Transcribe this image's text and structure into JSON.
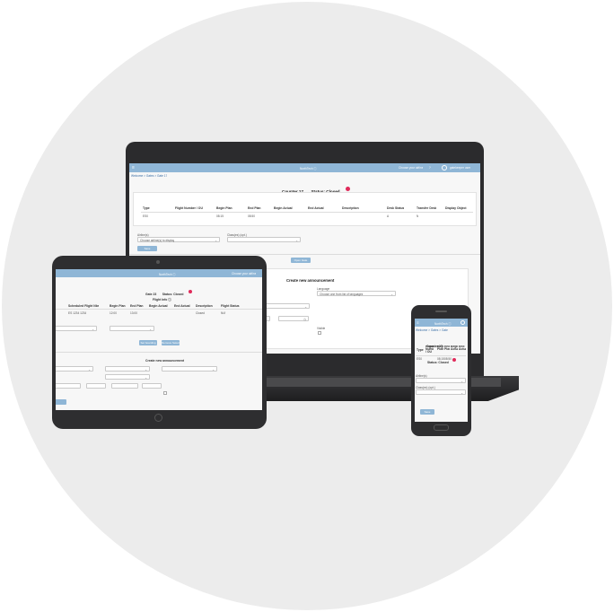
{
  "laptop": {
    "app_title": "NorthTech ⓘ",
    "header_link": "Choose your airline",
    "user_name": "gatekeeper user",
    "breadcrumb": "Welcome > Gates > Gate 17",
    "page_title": "Counter 17",
    "status_label": "Status: Closed",
    "table_headers": [
      "Type",
      "Flight Number / OU",
      "Begin Plan",
      "End Plan",
      "Begin Actual",
      "End Actual",
      "Description",
      "Desk Status",
      "Transfer Desk",
      "Display Object"
    ],
    "table_row": [
      "ES0",
      "",
      "08:15",
      "08:50",
      "",
      "",
      "",
      "A",
      "N",
      ""
    ],
    "airline_label": "Airline(s)",
    "airline_placeholder": "Choose airline(s) to display",
    "class_label": "Class(es) (opt.)",
    "save_button": "Save",
    "open_button": "Open Gate",
    "announcement_title": "Create new announcement",
    "lang_label": "Language",
    "lang_placeholder": "Choose one from list of languages",
    "visible_label": "Visible"
  },
  "tablet": {
    "app_title": "NorthTech ⓘ",
    "header_link": "Choose your airline",
    "page_title": "Gate 23",
    "status_label": "Status: Closed",
    "section_title": "Flight Info ⓘ",
    "table_headers": [
      "",
      "Scheduled Flight Nbr",
      "Begin Plan",
      "End Plan",
      "Begin Actual",
      "End Actual",
      "Description",
      "Flight Status"
    ],
    "table_row": [
      "",
      "ES 1234 1234",
      "12:00",
      "13:00",
      "",
      "",
      "Closed",
      "N/A"
    ],
    "button_left": "Set boarding",
    "button_right": "Remove Selected",
    "announcement_title": "Create new announcement"
  },
  "phone": {
    "app_title": "NorthTech ⓘ",
    "breadcrumb": "Welcome > Gates > Gate",
    "page_title": "Counter 17",
    "status_label": "Status: Closed",
    "table_headers": [
      "Type",
      "Flight Number / OU",
      "Begin Plan",
      "End Plan",
      "Begin Actual",
      "End Actual"
    ],
    "table_row": [
      "ES0",
      "",
      "08:15",
      "08:50",
      "",
      ""
    ],
    "airline_label": "Airline(s)",
    "class_label": "Class(es) (opt.)",
    "save_button": "Save"
  },
  "colors": {
    "header": "#8fb6d6",
    "status_badge": "#e02a5a",
    "device": "#2e2e30",
    "background": "#ececec"
  }
}
